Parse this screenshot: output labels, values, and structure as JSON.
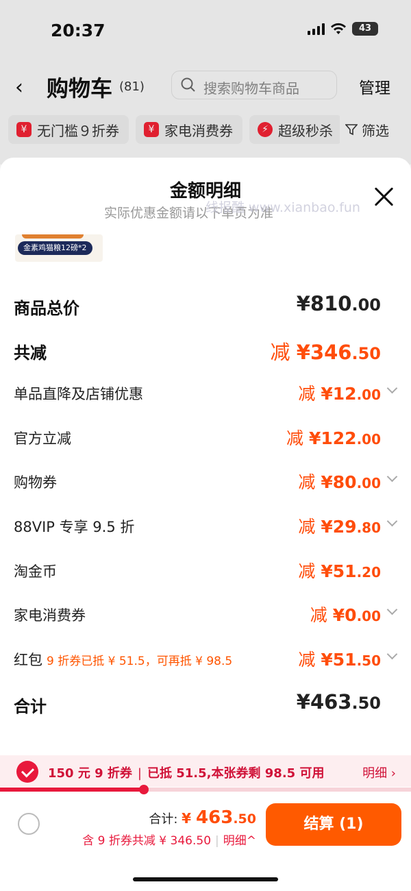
{
  "status_bar": {
    "time": "20:37",
    "battery": "43"
  },
  "nav": {
    "back": "‹",
    "title": "购物车",
    "count": "(81)",
    "search_placeholder": "搜索购物车商品",
    "manage": "管理"
  },
  "chips": [
    {
      "icon": "¥",
      "label": "无门槛９折券"
    },
    {
      "icon": "¥",
      "label": "家电消费券"
    },
    {
      "icon": "⚡",
      "label": "超级秒杀"
    }
  ],
  "filter": {
    "label": "筛选"
  },
  "sheet": {
    "title": "金额明细",
    "subtitle": "实际优惠金额请以下单页为准",
    "watermark": "线报酷 www.xianbao.fun",
    "product_tag": "金素鸡猫粮12磅*2"
  },
  "rows": [
    {
      "label": "商品总价",
      "prefix": "",
      "currency": "¥",
      "int": "810",
      "dec": ".00",
      "bold": true,
      "dark": true,
      "chevron": false
    },
    {
      "label": "共减",
      "prefix": "减 ",
      "currency": "¥",
      "int": "346",
      "dec": ".50",
      "bold": true,
      "dark": false,
      "chevron": false
    },
    {
      "label": "单品直降及店铺优惠",
      "prefix": "减 ",
      "currency": "¥",
      "int": "12",
      "dec": ".00",
      "bold": false,
      "dark": false,
      "chevron": true
    },
    {
      "label": "官方立减",
      "prefix": "减 ",
      "currency": "¥",
      "int": "122",
      "dec": ".00",
      "bold": false,
      "dark": false,
      "chevron": false
    },
    {
      "label": "购物券",
      "prefix": "减 ",
      "currency": "¥",
      "int": "80",
      "dec": ".00",
      "bold": false,
      "dark": false,
      "chevron": true
    },
    {
      "label": "88VIP 专享 9.5 折",
      "prefix": "减 ",
      "currency": "¥",
      "int": "29",
      "dec": ".80",
      "bold": false,
      "dark": false,
      "chevron": true
    },
    {
      "label": "淘金币",
      "prefix": "减 ",
      "currency": "¥",
      "int": "51",
      "dec": ".20",
      "bold": false,
      "dark": false,
      "chevron": false
    },
    {
      "label": "家电消费券",
      "prefix": "减 ",
      "currency": "¥",
      "int": "0",
      "dec": ".00",
      "bold": false,
      "dark": false,
      "chevron": true
    },
    {
      "label": "红包",
      "note": "9 折券已抵 ¥ 51.5，可再抵 ¥ 98.5",
      "prefix": "减 ",
      "currency": "¥",
      "int": "51",
      "dec": ".50",
      "bold": false,
      "dark": false,
      "chevron": true
    },
    {
      "label": "合计",
      "prefix": "",
      "currency": "¥",
      "int": "463",
      "dec": ".50",
      "bold": true,
      "dark": true,
      "chevron": false
    }
  ],
  "coupon": {
    "title": "150 元 9 折券",
    "status": "已抵 51.5,本张券剩 98.5 可用",
    "detail": "明细 ›",
    "progress": 0.35
  },
  "bottom": {
    "total_label": "合计: ",
    "total_currency": "¥ ",
    "total_int": "463",
    "total_dec": ".50",
    "saved": "含 9 折券共减 ¥ 346.50",
    "detail_link": "明细^",
    "checkout": "结算 (1)"
  },
  "colors": {
    "accent": "#ff4d0b",
    "coupon_red": "#e8193c",
    "checkout_bg": "#ff5a00"
  }
}
